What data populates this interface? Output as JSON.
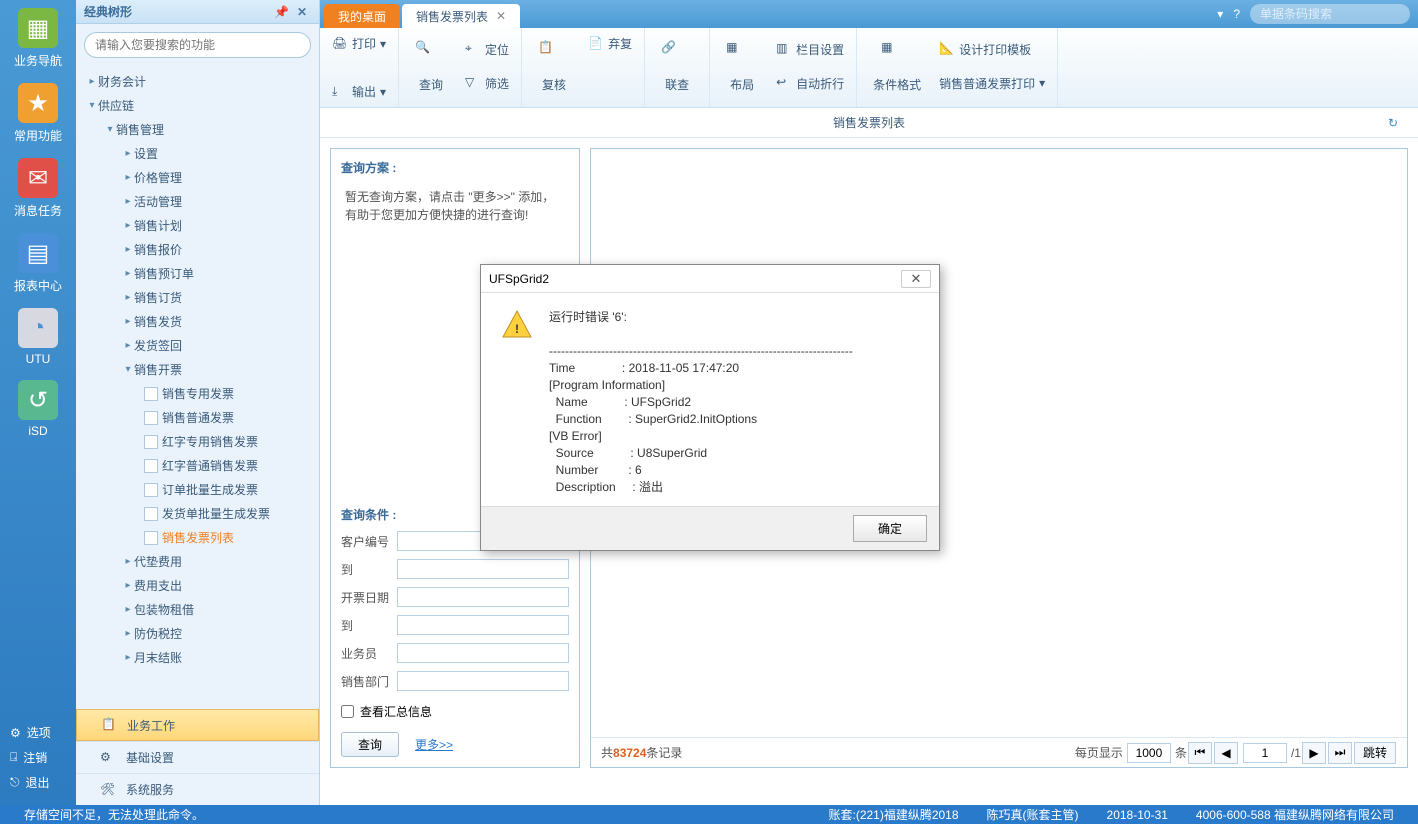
{
  "leftbar": [
    {
      "label": "业务导航",
      "color": "#7ab843"
    },
    {
      "label": "常用功能",
      "color": "#f0a030"
    },
    {
      "label": "消息任务",
      "color": "#e05048"
    },
    {
      "label": "报表中心",
      "color": "#4a90d8"
    },
    {
      "label": "UTU",
      "color": "#d8d8e0"
    },
    {
      "label": "iSD",
      "color": "#5ab890"
    }
  ],
  "leftbar_bottom": [
    "选项",
    "注销",
    "退出"
  ],
  "sidepanel": {
    "title": "经典树形",
    "search_placeholder": "请输入您要搜索的功能"
  },
  "tree": {
    "top": [
      "财务会计"
    ],
    "supply": "供应链",
    "sales_mgmt": "销售管理",
    "mid": [
      "设置",
      "价格管理",
      "活动管理",
      "销售计划",
      "销售报价",
      "销售预订单",
      "销售订货",
      "销售发货",
      "发货签回"
    ],
    "invoice": "销售开票",
    "leaves": [
      "销售专用发票",
      "销售普通发票",
      "红字专用销售发票",
      "红字普通销售发票",
      "订单批量生成发票",
      "发货单批量生成发票",
      "销售发票列表"
    ],
    "tail": [
      "代垫费用",
      "费用支出",
      "包装物租借",
      "防伪税控",
      "月末结账"
    ]
  },
  "side_bottom": [
    {
      "label": "业务工作",
      "active": true
    },
    {
      "label": "基础设置",
      "active": false
    },
    {
      "label": "系统服务",
      "active": false
    }
  ],
  "tabs": {
    "home": "我的桌面",
    "active": "销售发票列表"
  },
  "tabs_right": {
    "search_placeholder": "单据条码搜索"
  },
  "ribbon": {
    "g1": {
      "print": "打印",
      "output": "输出"
    },
    "g2": {
      "query": "查询",
      "locate": "定位",
      "filter": "筛选"
    },
    "g3": {
      "recheck": "复核",
      "abandon": "弃复"
    },
    "g4": {
      "link": "联查"
    },
    "g5": {
      "layout": "布局",
      "cols": "栏目设置",
      "wrap": "自动折行"
    },
    "g6": {
      "cond": "条件格式",
      "tpl": "设计打印模板",
      "printset": "销售普通发票打印"
    }
  },
  "page_title": "销售发票列表",
  "query_panel": {
    "plan_title": "查询方案 :",
    "plan_text": "暂无查询方案，请点击 \"更多>>\" 添加，有助于您更加方便快捷的进行查询!",
    "cond_title": "查询条件 :",
    "fields": [
      "客户编号",
      "到",
      "开票日期",
      "到",
      "业务员",
      "销售部门"
    ],
    "checkbox": "查看汇总信息",
    "query_btn": "查询",
    "more": "更多>>"
  },
  "pager": {
    "prefix": "共",
    "count": "83724",
    "suffix": "条记录",
    "perpage_label": "每页显示",
    "perpage": "1000",
    "unit": "条",
    "page": "1",
    "total": "1",
    "jump": "跳转"
  },
  "dialog": {
    "title": "UFSpGrid2",
    "body": "运行时错误 '6':\n\n----------------------------------------------------------------------------\nTime              : 2018-11-05 17:47:20\n[Program Information]\n  Name           : UFSpGrid2\n  Function        : SuperGrid2.InitOptions\n[VB Error]\n  Source           : U8SuperGrid\n  Number         : 6\n  Description     : 溢出",
    "ok": "确定"
  },
  "status": {
    "left": "存储空间不足，无法处理此命令。",
    "acct": "账套:(221)福建纵腾2018",
    "user": "陈巧真(账套主管)",
    "date": "2018-10-31",
    "phone": "4006-600-588 福建纵腾网络有限公司"
  }
}
